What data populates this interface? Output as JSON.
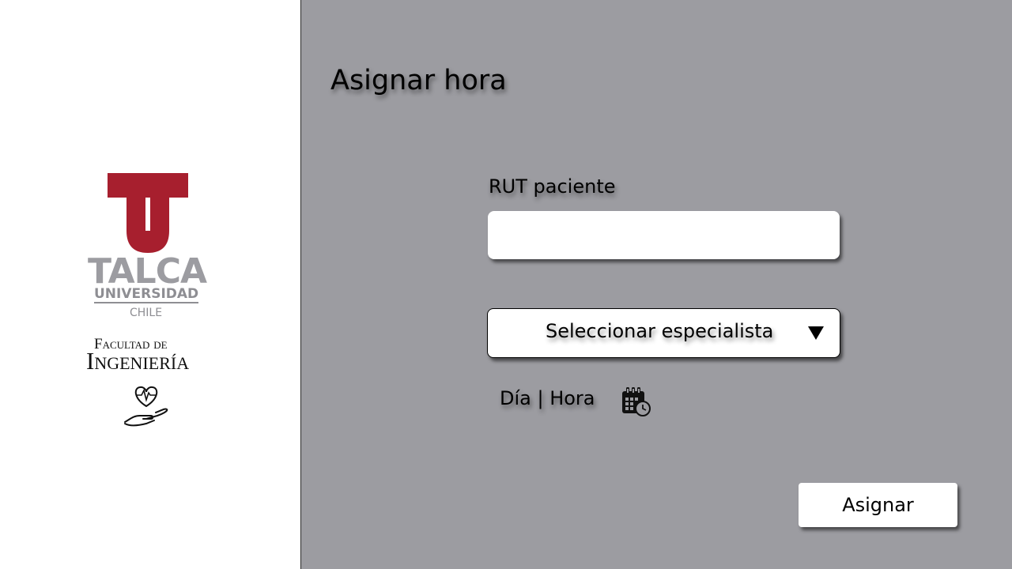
{
  "sidebar": {
    "logo": {
      "name": "TALCA",
      "subtitle": "UNIVERSIDAD",
      "country": "CHILE",
      "faculty_prefix": "Facultad de",
      "faculty_name": "Ingeniería",
      "icon": "heart-hand-icon",
      "brand_color": "#a71f2e",
      "gray_color": "#9c9ca1"
    }
  },
  "main": {
    "background_color": "#9c9ca1",
    "title": "Asignar hora",
    "rut": {
      "label": "RUT paciente",
      "value": "",
      "placeholder": ""
    },
    "specialist": {
      "selected": "Seleccionar especialista",
      "icon": "triangle-down-icon"
    },
    "datetime": {
      "label": "Día | Hora",
      "icon": "calendar-clock-icon"
    },
    "submit_label": "Asignar"
  }
}
